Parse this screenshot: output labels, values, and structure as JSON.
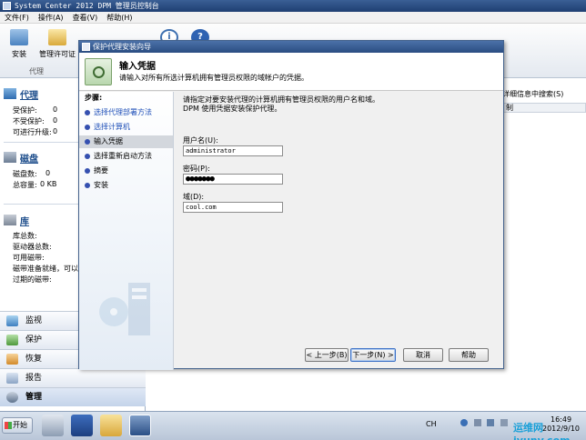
{
  "window": {
    "title": "System Center 2012 DPM 管理员控制台"
  },
  "menu": [
    "文件(F)",
    "操作(A)",
    "查看(V)",
    "帮助(H)"
  ],
  "toolbar": {
    "install_label": "安装",
    "license_label": "管理许可证",
    "group_label": "代理"
  },
  "agents": {
    "header": "代理",
    "stats": [
      {
        "label": "受保护:",
        "value": "0"
      },
      {
        "label": "不受保护:",
        "value": "0"
      },
      {
        "label": "可进行升级:",
        "value": "0"
      }
    ]
  },
  "disks": {
    "header": "磁盘",
    "stats": [
      {
        "label": "磁盘数:",
        "value": "0"
      },
      {
        "label": "总容量:",
        "value": "0 KB"
      }
    ]
  },
  "libraries": {
    "header": "库",
    "stats": [
      {
        "label": "库总数:"
      },
      {
        "label": "驱动器总数:"
      },
      {
        "label": "可用磁带:"
      },
      {
        "label": "磁带准备就绪，可以Ü"
      },
      {
        "label": "过期的磁带:"
      }
    ]
  },
  "workspaces": [
    "监视",
    "保护",
    "恢复",
    "报告",
    "管理"
  ],
  "right": {
    "search_hint": "详细信息中搜索(S)",
    "column": "制"
  },
  "dialog": {
    "title": "保护代理安装向导",
    "header_title": "输入凭据",
    "header_sub": "请输入对所有所选计算机拥有管理员权限的域帐户的凭据。",
    "steps_label": "步骤:",
    "steps": [
      "选择代理部署方法",
      "选择计算机",
      "输入凭据",
      "选择重新启动方法",
      "摘要",
      "安装"
    ],
    "intro_line1": "请指定对要安装代理的计算机拥有管理员权限的用户名和域。",
    "intro_line2": "DPM 使用凭据安装保护代理。",
    "username_label": "用户名(U):",
    "username_value": "administrator",
    "password_label": "密码(P):",
    "password_value": "●●●●●●●",
    "domain_label": "域(D):",
    "domain_value": "cool.com",
    "buttons": {
      "back": "< 上一步(B)",
      "next": "下一步(N) >",
      "cancel": "取消",
      "help": "帮助"
    }
  },
  "taskbar": {
    "start_label": "开始",
    "tray_lang": "CH",
    "clock_time": "16:49",
    "clock_date": "2012/9/10"
  },
  "watermark": "运维网 iyunv.com"
}
